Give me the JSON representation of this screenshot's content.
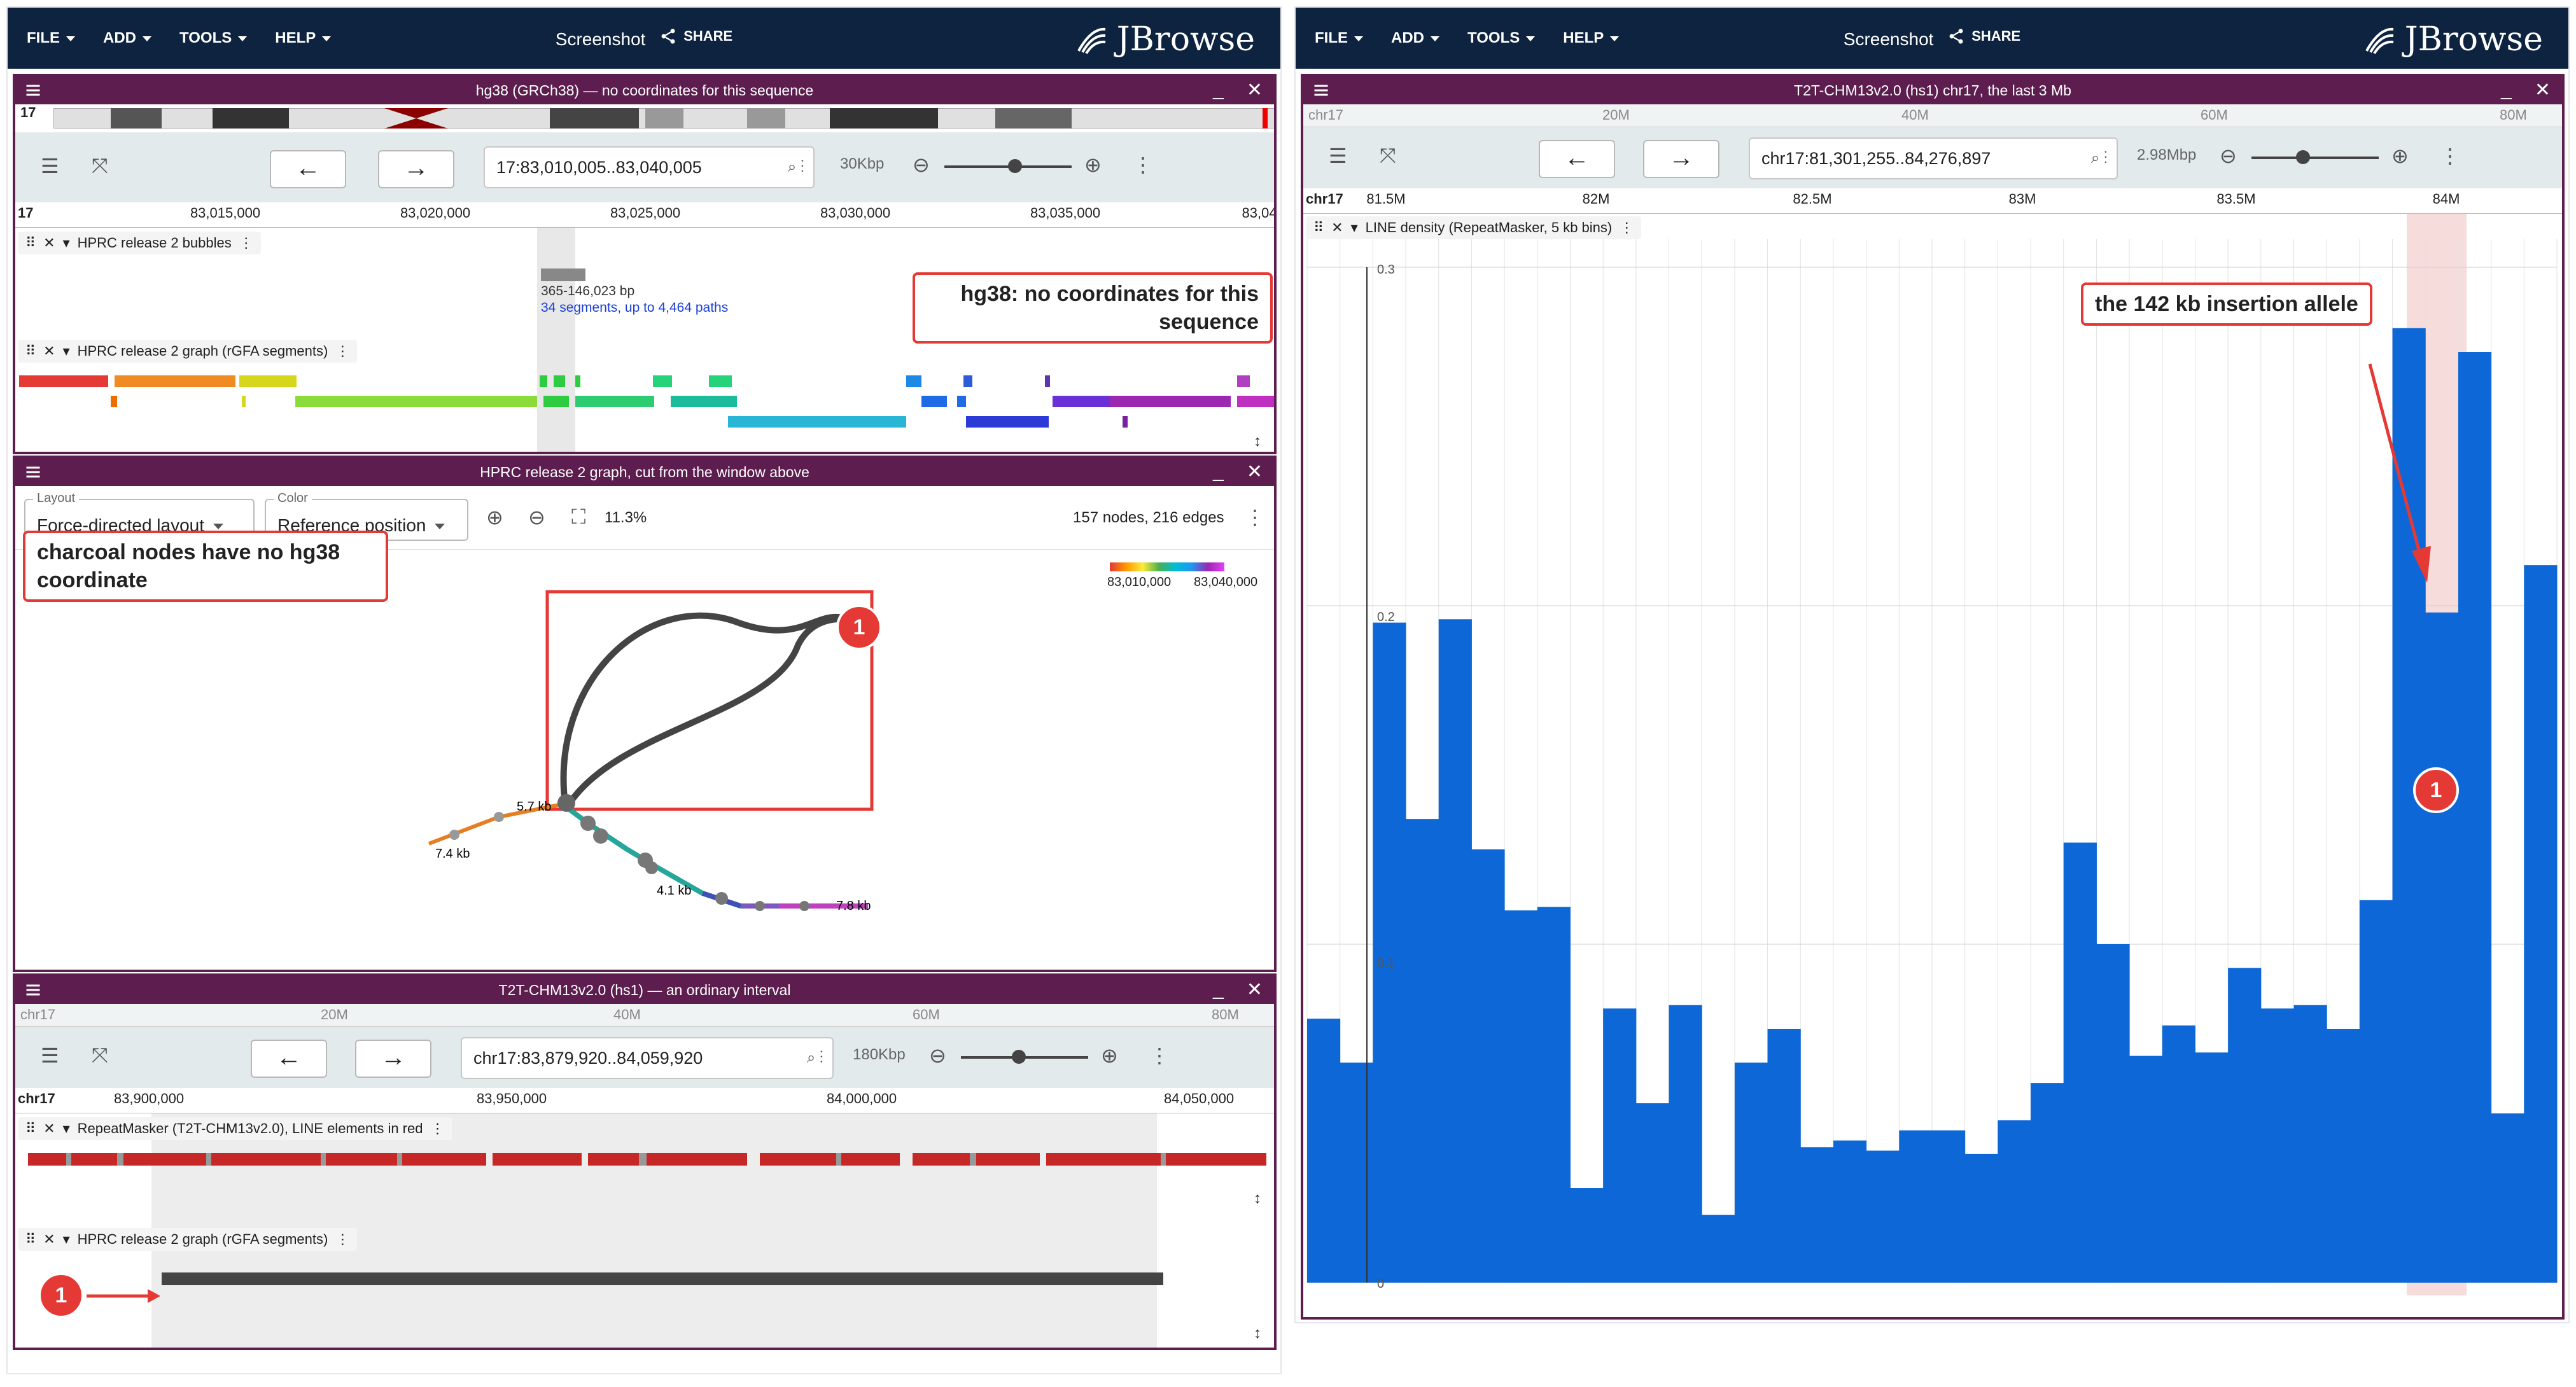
{
  "left": {
    "menu": [
      "FILE",
      "ADD",
      "TOOLS",
      "HELP"
    ],
    "session_name": "Screenshot",
    "share": "SHARE",
    "logo": "JBrowse",
    "view1": {
      "title": "hg38 (GRCh38) — no coordinates for this sequence",
      "ideogram_chrom": "17",
      "location": "17:83,010,005..83,040,005",
      "bp_per_view": "30Kbp",
      "ruler_ref": "17",
      "ticks": [
        "83,015,000",
        "83,020,000",
        "83,025,000",
        "83,030,000",
        "83,035,000",
        "83,04"
      ],
      "track1_name": "HPRC release 2 bubbles",
      "bubble_size": "365-146,023 bp",
      "bubble_desc": "34 segments, up to 4,464 paths",
      "track2_name": "HPRC release 2 graph (rGFA segments)",
      "callout": "hg38: no coordinates for this sequence"
    },
    "view2": {
      "title": "HPRC release 2 graph, cut from the window above",
      "layout_label": "Layout",
      "layout_value": "Force-directed layout",
      "color_label": "Color",
      "color_value": "Reference position",
      "zoom_pct": "11.3%",
      "node_edge_count": "157 nodes, 216 edges",
      "legend_start": "83,010,000",
      "legend_end": "83,040,000",
      "callout": "charcoal nodes have no hg38 coordinate",
      "badge": "1",
      "node_labels": [
        "7.4 kb",
        "5.7 kb",
        "4.1 kb",
        "7.8 kb"
      ]
    },
    "view3": {
      "title": "T2T-CHM13v2.0 (hs1) — an ordinary interval",
      "overview_chrom": "chr17",
      "overview_ticks": [
        "20M",
        "40M",
        "60M",
        "80M"
      ],
      "location": "chr17:83,879,920..84,059,920",
      "bp_per_view": "180Kbp",
      "ruler_ref": "chr17",
      "ticks": [
        "83,900,000",
        "83,950,000",
        "84,000,000",
        "84,050,000"
      ],
      "track1_name": "RepeatMasker (T2T-CHM13v2.0), LINE elements in red",
      "track2_name": "HPRC release 2 graph (rGFA segments)",
      "badge": "1"
    }
  },
  "right": {
    "menu": [
      "FILE",
      "ADD",
      "TOOLS",
      "HELP"
    ],
    "session_name": "Screenshot",
    "share": "SHARE",
    "logo": "JBrowse",
    "view": {
      "title": "T2T-CHM13v2.0 (hs1) chr17, the last 3 Mb",
      "overview_chrom": "chr17",
      "overview_ticks": [
        "20M",
        "40M",
        "60M",
        "80M"
      ],
      "location": "chr17:81,301,255..84,276,897",
      "bp_per_view": "2.98Mbp",
      "ruler_ref": "chr17",
      "ticks": [
        "81.5M",
        "82M",
        "82.5M",
        "83M",
        "83.5M",
        "84M"
      ],
      "track_name": "LINE density (RepeatMasker, 5 kb bins)",
      "y_ticks": [
        "0.3",
        "0.2",
        "0.1",
        "0"
      ],
      "callout": "the 142 kb insertion allele",
      "badge": "1"
    }
  },
  "chart_data": {
    "type": "bar",
    "ylim": [
      0,
      0.3
    ],
    "values": [
      0.078,
      0.065,
      0.195,
      0.137,
      0.196,
      0.128,
      0.11,
      0.111,
      0.028,
      0.081,
      0.053,
      0.082,
      0.02,
      0.065,
      0.075,
      0.04,
      0.042,
      0.039,
      0.045,
      0.045,
      0.038,
      0.048,
      0.059,
      0.13,
      0.1,
      0.067,
      0.076,
      0.068,
      0.093,
      0.081,
      0.082,
      0.075,
      0.113,
      0.282,
      0.198,
      0.275,
      0.05,
      0.212
    ]
  },
  "colors": {
    "topbar": "#0d233f",
    "view_title": "#5d1e4f",
    "bar": "#0d67d6",
    "callout": "#e53935",
    "highlight": "#f2c4c4"
  }
}
